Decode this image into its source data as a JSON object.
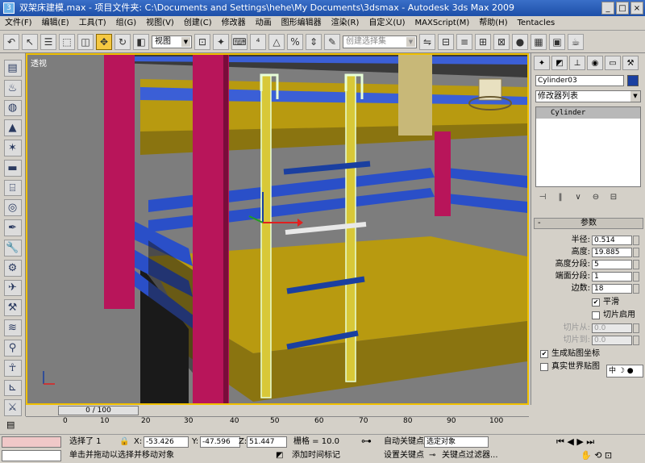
{
  "window": {
    "title": "双架床建模.max - 项目文件夹: C:\\Documents and Settings\\hehe\\My Documents\\3dsmax - Autodesk 3ds Max 2009",
    "min": "_",
    "max": "□",
    "close": "×"
  },
  "menu": [
    "文件(F)",
    "编辑(E)",
    "工具(T)",
    "组(G)",
    "视图(V)",
    "创建(C)",
    "修改器",
    "动画",
    "图形编辑器",
    "渲染(R)",
    "自定义(U)",
    "MAXScript(M)",
    "帮助(H)",
    "Tentacles"
  ],
  "toolbar": {
    "view_select": "视图",
    "selection_set": "创建选择集"
  },
  "viewport": {
    "label": "透视"
  },
  "command_panel": {
    "object_name": "Cylinder03",
    "object_color": "#1a3fa0",
    "modifier_list": "修改器列表",
    "stack_item": "Cylinder",
    "rollout_title": "参数",
    "params": [
      {
        "label": "半径:",
        "value": "0.514"
      },
      {
        "label": "高度:",
        "value": "19.885"
      },
      {
        "label": "高度分段:",
        "value": "5"
      },
      {
        "label": "端面分段:",
        "value": "1"
      },
      {
        "label": "边数:",
        "value": "18"
      }
    ],
    "smooth_label": "平滑",
    "slice_on_label": "切片启用",
    "slice_from_label": "切片从:",
    "slice_from_value": "0.0",
    "slice_to_label": "切片到:",
    "slice_to_value": "0.0",
    "gen_map_label": "生成贴图坐标",
    "real_world_label": "真实世界贴图",
    "ime_text": "中 ☽ ●"
  },
  "timeline": {
    "slider_text": "0 / 100",
    "ticks": [
      "0",
      "10",
      "20",
      "30",
      "40",
      "50",
      "60",
      "70",
      "80",
      "90",
      "100"
    ]
  },
  "status": {
    "selected": "选择了 1",
    "x_label": "X:",
    "x_value": "-53.426",
    "y_label": "Y:",
    "y_value": "-47.596",
    "z_label": "Z:",
    "z_value": "51.447",
    "grid": "栅格 = 10.0",
    "auto_key": "自动关键点",
    "selected_object": "选定对象",
    "set_key": "设置关键点",
    "key_filters": "关键点过滤器...",
    "prompt": "单击并拖动以选择并移动对象",
    "add_time_tag": "添加时间标记"
  }
}
